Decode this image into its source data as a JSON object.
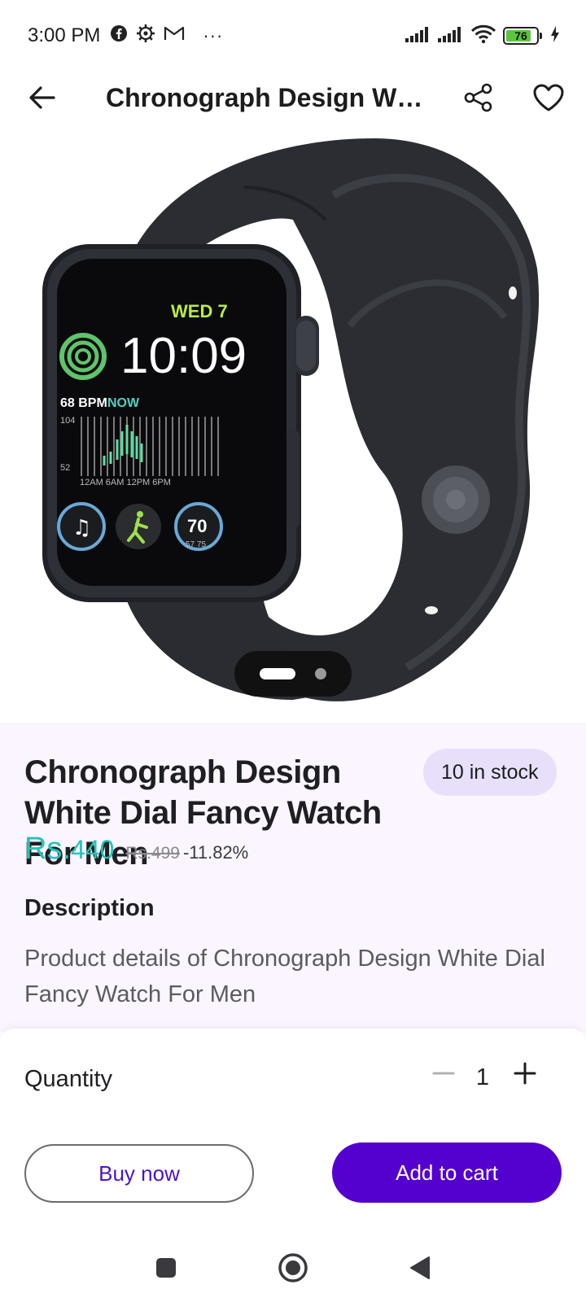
{
  "status_bar": {
    "time": "3:00 PM",
    "more": "···",
    "battery_level": "76",
    "icons": [
      "facebook-icon",
      "settings-gear-icon",
      "gmail-icon",
      "signal-icon",
      "signal-icon",
      "wifi-icon",
      "battery-icon",
      "charging-icon"
    ]
  },
  "header": {
    "title": "Chronograph Design White Dial Fancy Watch For Men",
    "back_icon": "arrow-left-icon",
    "share_icon": "share-icon",
    "favorite_icon": "heart-icon"
  },
  "gallery": {
    "image_count": 2,
    "active_index": 0
  },
  "product": {
    "title": "Chronograph Design White Dial Fancy Watch For Men",
    "stock_badge": "10 in stock",
    "price_currency": "Rs.",
    "price_value": "440",
    "original_price": "Rs.499",
    "discount": "-11.82%",
    "description_heading": "Description",
    "description_text": "Product details of Chronograph Design White Dial Fancy Watch For Men",
    "price_color": "#21c4b8"
  },
  "purchase": {
    "quantity_label": "Quantity",
    "quantity_value": "1",
    "buy_now_label": "Buy now",
    "add_to_cart_label": "Add to cart",
    "accent_color": "#5400cf"
  },
  "nav_bar": {
    "recents_icon": "square-icon",
    "home_icon": "circle-home-icon",
    "back_icon": "triangle-back-icon"
  }
}
